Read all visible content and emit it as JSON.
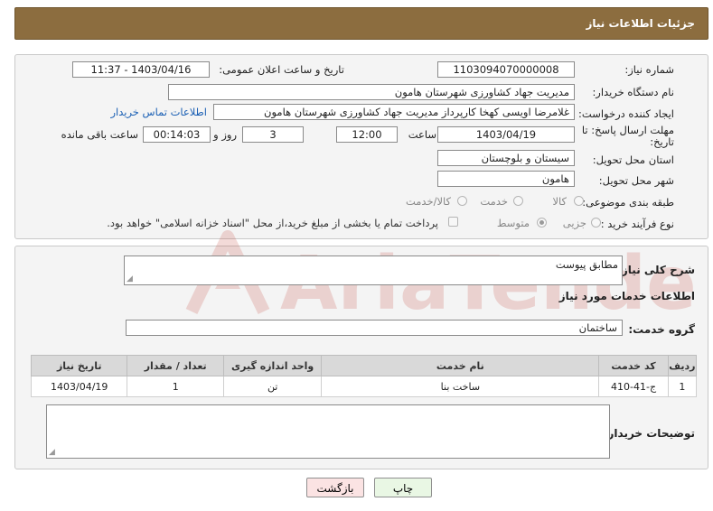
{
  "header": {
    "title": "جزئیات اطلاعات نیاز"
  },
  "form": {
    "need_number_label": "شماره نیاز:",
    "need_number": "1103094070000008",
    "announce_label": "تاریخ و ساعت اعلان عمومی:",
    "announce_value": "1403/04/16 - 11:37",
    "buyer_org_label": "نام دستگاه خریدار:",
    "buyer_org": "مدیریت جهاد کشاورزی شهرستان  هامون",
    "creator_label": "ایجاد کننده درخواست:",
    "creator": "غلامرضا اویسی کهخا کارپرداز مدیریت جهاد کشاورزی شهرستان  هامون",
    "contact_link": "اطلاعات تماس خریدار",
    "deadline_label_1": "مهلت ارسال پاسخ: تا",
    "deadline_label_2": "تاریخ:",
    "deadline_date": "1403/04/19",
    "time_label": "ساعت",
    "deadline_time": "12:00",
    "days_value": "3",
    "days_label": "روز و",
    "remaining_time": "00:14:03",
    "remaining_label": "ساعت باقی مانده",
    "province_label": "استان محل تحویل:",
    "province": "سیستان و بلوچستان",
    "city_label": "شهر محل تحویل:",
    "city": "هامون",
    "category_label": "طبقه بندی موضوعی:",
    "category_options": [
      "کالا",
      "خدمت",
      "کالا/خدمت"
    ],
    "process_label": "نوع فرآیند خرید :",
    "process_options": [
      "جزیی",
      "متوسط"
    ],
    "payment_note": "پرداخت تمام یا بخشی از مبلغ خرید،از محل \"اسناد خزانه اسلامی\" خواهد بود."
  },
  "details": {
    "summary_label": "شرح کلی نیاز:",
    "summary_value": "مطابق پیوست",
    "services_heading": "اطلاعات خدمات مورد نیاز",
    "service_group_label": "گروه خدمت:",
    "service_group_value": "ساختمان",
    "table": {
      "headers": [
        "ردیف",
        "کد خدمت",
        "نام خدمت",
        "واحد اندازه گیری",
        "تعداد / مقدار",
        "تاریخ نیاز"
      ],
      "rows": [
        [
          "1",
          "ج-41-410",
          "ساخت بنا",
          "تن",
          "1",
          "1403/04/19"
        ]
      ]
    },
    "buyer_notes_label": "توضیحات خریدار:",
    "buyer_notes_value": ""
  },
  "buttons": {
    "print": "چاپ",
    "back": "بازگشت"
  },
  "watermark": {
    "text": "AriaTender.neT"
  },
  "colors": {
    "header_bg": "#8c6d3f",
    "link": "#1a5fb4",
    "watermark": "#c0392b"
  }
}
